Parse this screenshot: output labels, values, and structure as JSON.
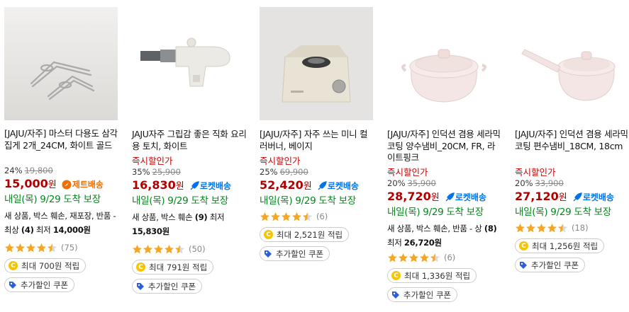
{
  "products": [
    {
      "name": "[JAJU/자주] 마스터 다용도 삼각집게 2개_24CM, 화이트 골드",
      "instant_label": "",
      "discount_rate": "24%",
      "original_price": "19,800",
      "price": "15,000",
      "won": "원",
      "delivery_badge": "제트배송",
      "delivery": "내일(목) 9/29 도착 보장",
      "used_prefix": "새 상품, 박스 훼손, 재포장, 반품 - 최상 ",
      "used_count": "(4)",
      "used_mid": " 최저 ",
      "used_price": "14,000원",
      "rating": 4.5,
      "review_count": "(75)",
      "cashback": "최대 700원 적립",
      "coupon": "추가할인 쿠폰"
    },
    {
      "name": "JAJU자주 그립감 좋은 직화 요리용 토치, 화이트",
      "instant_label": "즉시할인가",
      "discount_rate": "35%",
      "original_price": "25,900",
      "price": "16,830",
      "won": "원",
      "delivery_badge": "로켓배송",
      "delivery": "내일(목) 9/29 도착 보장",
      "used_prefix": "새 상품, 박스 훼손 ",
      "used_count": "(9)",
      "used_mid": " 최저 ",
      "used_price": "15,830원",
      "rating": 4.5,
      "review_count": "(50)",
      "cashback": "최대 791원 적립",
      "coupon": "추가할인 쿠폰"
    },
    {
      "name": "[JAJU/자주] 자주 쓰는 미니 컬러버너, 베이지",
      "instant_label": "즉시할인가",
      "discount_rate": "25%",
      "original_price": "69,900",
      "price": "52,420",
      "won": "원",
      "delivery_badge": "로켓배송",
      "delivery": "내일(목) 9/29 도착 보장",
      "rating": 4.5,
      "review_count": "(6)",
      "cashback": "최대 2,521원 적립",
      "coupon": "추가할인 쿠폰"
    },
    {
      "name": "[JAJU/자주] 인덕션 겸용 세라믹 코팅 양수냄비_20CM, FR, 라이트핑크",
      "instant_label": "즉시할인가",
      "discount_rate": "20%",
      "original_price": "35,900",
      "price": "28,720",
      "won": "원",
      "delivery_badge": "로켓배송",
      "delivery": "내일(목) 9/29 도착 보장",
      "used_prefix": "새 상품, 박스 훼손, 반품 - 상 ",
      "used_count": "(8)",
      "used_mid": " 최저 ",
      "used_price": "26,720원",
      "rating": 4.5,
      "review_count": "(6)",
      "cashback": "최대 1,336원 적립",
      "coupon": "추가할인 쿠폰"
    },
    {
      "name": "[JAJU/자주] 인덕션 겸용 세라믹 코팅 편수냄비_18CM, 18cm",
      "instant_label": "즉시할인가",
      "discount_rate": "20%",
      "original_price": "33,900",
      "price": "27,120",
      "won": "원",
      "delivery_badge": "로켓배송",
      "delivery": "내일(목) 9/29 도착 보장",
      "rating": 4.5,
      "review_count": "(18)",
      "cashback": "최대 1,256원 적립",
      "coupon": "추가할인 쿠폰"
    }
  ],
  "icons": {
    "star": "star-icon",
    "coin": "coin-icon",
    "coupon": "coupon-icon",
    "rocket": "rocket-icon",
    "jet": "jet-delivery-icon"
  },
  "colors": {
    "price": "#ae0000",
    "delivery": "#00891a",
    "rocket": "#0073e9",
    "jet": "#ef6e00",
    "star": "#f5a623"
  }
}
